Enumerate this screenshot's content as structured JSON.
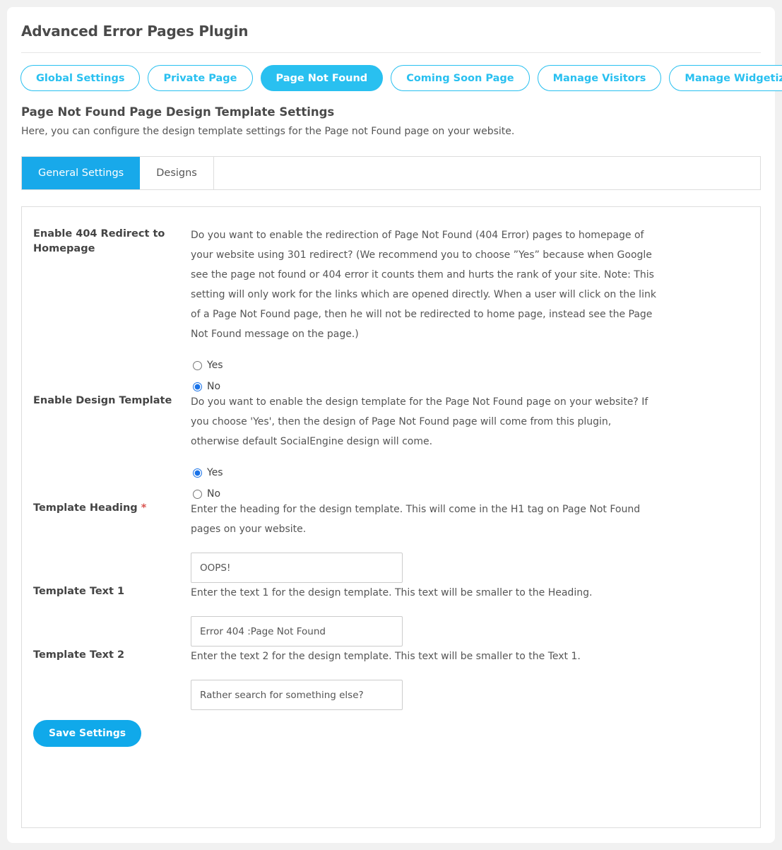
{
  "header": {
    "title": "Advanced Error Pages Plugin"
  },
  "pill_nav": {
    "items": [
      {
        "label": "Global Settings",
        "active": false
      },
      {
        "label": "Private Page",
        "active": false
      },
      {
        "label": "Page Not Found",
        "active": true
      },
      {
        "label": "Coming Soon Page",
        "active": false
      },
      {
        "label": "Manage Visitors",
        "active": false
      },
      {
        "label": "Manage Widgetized Pages",
        "active": false
      }
    ]
  },
  "section": {
    "title": "Page Not Found Page Design Template Settings",
    "description": "Here, you can configure the design template settings for the Page not Found page on your website."
  },
  "tabs": [
    {
      "label": "General Settings",
      "active": true
    },
    {
      "label": "Designs",
      "active": false
    }
  ],
  "form": {
    "redirect": {
      "label": "Enable 404 Redirect to Homepage",
      "help": "Do you want to enable the redirection of Page Not Found (404 Error) pages to homepage of your website using 301 redirect? (We recommend you to choose ”Yes” because when Google see the page not found or 404 error it counts them and hurts the rank of your site. Note: This setting will only work for the links which are opened directly. When a user will click on the link of a Page Not Found page, then he will not be redirected to home page, instead see the Page Not Found message on the page.)",
      "options": [
        {
          "label": "Yes",
          "selected": false
        },
        {
          "label": "No",
          "selected": true
        }
      ]
    },
    "design_template": {
      "label": "Enable Design Template",
      "help": "Do you want to enable the design template for the Page Not Found page on your website? If you choose 'Yes', then the design of Page Not Found page will come from this plugin, otherwise default SocialEngine design will come.",
      "options": [
        {
          "label": "Yes",
          "selected": true
        },
        {
          "label": "No",
          "selected": false
        }
      ]
    },
    "template_heading": {
      "label": "Template Heading",
      "required_marker": "*",
      "help": "Enter the heading for the design template. This will come in the H1 tag on Page Not Found pages on your website.",
      "value": "OOPS!",
      "placeholder": ""
    },
    "template_text_1": {
      "label": "Template Text 1",
      "help": "Enter the text 1 for the design template. This text will be smaller to the Heading.",
      "value": "Error 404 :Page Not Found",
      "placeholder": ""
    },
    "template_text_2": {
      "label": "Template Text 2",
      "help": "Enter the text 2 for the design template. This text will be smaller to the Text 1.",
      "value": "Rather search for something else?",
      "placeholder": ""
    },
    "save_label": "Save Settings"
  },
  "colors": {
    "accent": "#29c0f0",
    "accent_dark": "#10a9ea",
    "tab_active": "#18a9ea",
    "required": "#d9534f",
    "page_bg": "#f1f1f1"
  }
}
